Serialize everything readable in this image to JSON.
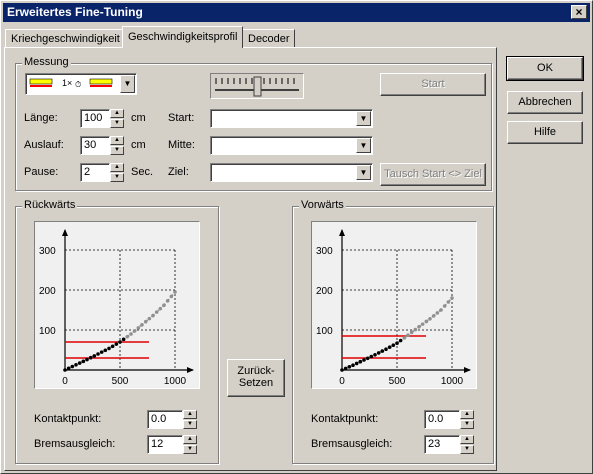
{
  "window": {
    "title": "Erweitertes Fine-Tuning",
    "close_glyph": "×"
  },
  "tabs": [
    {
      "label": "Kriechgeschwindigkeit"
    },
    {
      "label": "Geschwindigkeitsprofil"
    },
    {
      "label": "Decoder"
    }
  ],
  "buttons": {
    "ok": "OK",
    "cancel": "Abbrechen",
    "help": "Hilfe",
    "start": "Start",
    "swap": "Tausch Start <> Ziel",
    "reset_line1": "Zurück-",
    "reset_line2": "Setzen"
  },
  "messung": {
    "group_label": "Messung",
    "selector_text": "1×",
    "length": {
      "label": "Länge:",
      "value": "100",
      "unit": "cm"
    },
    "runout": {
      "label": "Auslauf:",
      "value": "30",
      "unit": "cm"
    },
    "pause": {
      "label": "Pause:",
      "value": "2",
      "unit": "Sec."
    },
    "start": {
      "label": "Start:",
      "value": ""
    },
    "middle": {
      "label": "Mitte:",
      "value": ""
    },
    "target": {
      "label": "Ziel:",
      "value": ""
    }
  },
  "reverse": {
    "group_label": "Rückwärts",
    "contact_label": "Kontaktpunkt:",
    "contact_value": "0.0",
    "brake_label": "Bremsausgleich:",
    "brake_value": "12"
  },
  "forward": {
    "group_label": "Vorwärts",
    "contact_label": "Kontaktpunkt:",
    "contact_value": "0.0",
    "brake_label": "Bremsausgleich:",
    "brake_value": "23"
  },
  "colors": {
    "red": "#e00000",
    "grey_dots": "#909090",
    "black_dots": "#000000",
    "titlebar": "#0a246a"
  },
  "chart_data": [
    {
      "type": "line",
      "title": "",
      "xticks": [
        "0",
        "500",
        "1000"
      ],
      "yticks": [
        "100",
        "200",
        "300"
      ],
      "xlim": [
        0,
        1000
      ],
      "ylim": [
        0,
        300
      ],
      "grid": "dashed",
      "series": [
        {
          "values_x": [
            0,
            100,
            200,
            300,
            400,
            500,
            600,
            700,
            800,
            900,
            1000
          ],
          "values_y": [
            0,
            13,
            26,
            40,
            54,
            70,
            90,
            113,
            136,
            162,
            195
          ]
        }
      ],
      "hlines": [
        30,
        70
      ]
    },
    {
      "type": "line",
      "title": "",
      "xticks": [
        "0",
        "500",
        "1000"
      ],
      "yticks": [
        "100",
        "200",
        "300"
      ],
      "xlim": [
        0,
        1000
      ],
      "ylim": [
        0,
        300
      ],
      "grid": "dashed",
      "series": [
        {
          "values_x": [
            0,
            100,
            200,
            300,
            400,
            500,
            600,
            700,
            800,
            900,
            1000
          ],
          "values_y": [
            0,
            12,
            25,
            38,
            52,
            67,
            87,
            108,
            128,
            150,
            180
          ]
        }
      ],
      "hlines": [
        30,
        85
      ]
    }
  ]
}
